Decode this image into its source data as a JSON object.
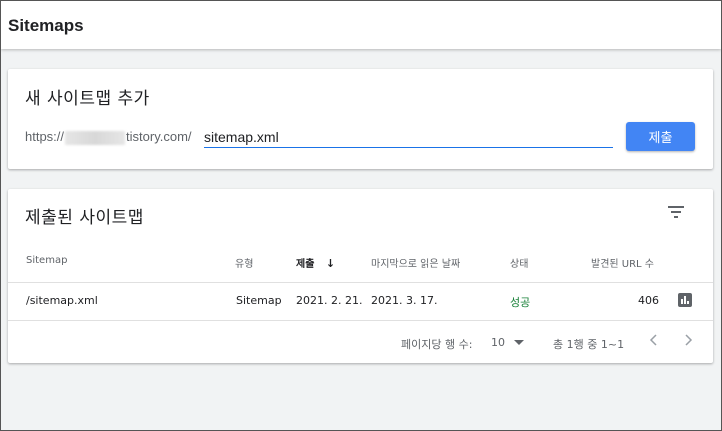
{
  "header": {
    "title": "Sitemaps"
  },
  "add_sitemap": {
    "title": "새 사이트맵 추가",
    "url_prefix_start": "https://",
    "url_prefix_end": "tistory.com/",
    "input_value": "sitemap.xml",
    "submit_label": "제출"
  },
  "submitted": {
    "title": "제출된 사이트맵",
    "columns": [
      "Sitemap",
      "유형",
      "제출",
      "마지막으로 읽은 날짜",
      "상태",
      "발견된 URL 수"
    ],
    "sort_arrow": "↓",
    "rows": [
      {
        "sitemap": "/sitemap.xml",
        "type": "Sitemap",
        "submitted": "2021. 2. 21.",
        "last_read": "2021. 3. 17.",
        "status": "성공",
        "urls": "406"
      }
    ],
    "footer": {
      "rows_per_page_label": "페이지당 행 수:",
      "rows_per_page_value": "10",
      "range_text": "총 1행 중 1~1"
    }
  },
  "colors": {
    "accent": "#4285f4",
    "success": "#188038"
  },
  "icons": [
    "filter-icon",
    "report-icon",
    "chevron-left-icon",
    "chevron-right-icon",
    "dropdown-caret-icon"
  ]
}
